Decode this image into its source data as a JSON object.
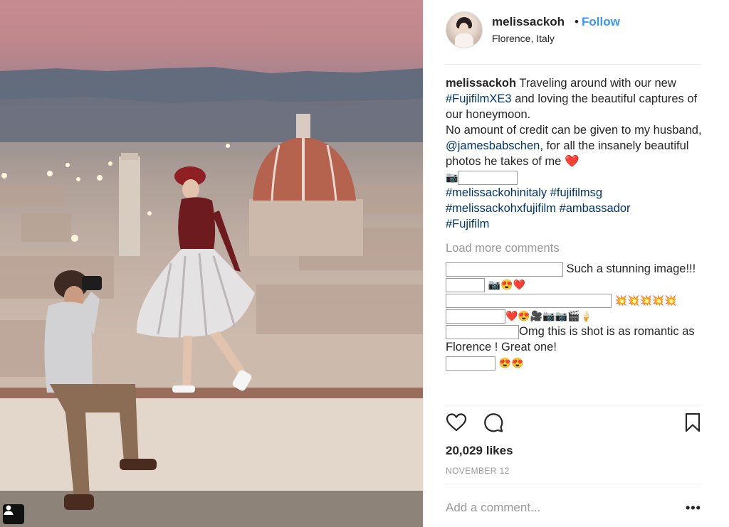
{
  "post": {
    "username": "melissackoh",
    "separator": "•",
    "follow_label": "Follow",
    "location": "Florence, Italy"
  },
  "caption": {
    "username": "melissackoh",
    "text_1": " Traveling around with our new ",
    "hashtag_xe3": "#FujifilmXE3",
    "text_2": " and loving the beautiful captures of our honeymoon.",
    "text_3": "No amount of credit can be given to my husband, ",
    "mention": "@jamesbabschen",
    "text_4": ", for all the insanely beautiful photos he takes of me ",
    "heart": "❤️",
    "camera": "📷",
    "hashtags": [
      "#melissackohinitaly",
      "#fujifilmsg",
      "#melissackohxfujifilm",
      "#ambassador",
      "#Fujifilm"
    ]
  },
  "load_more_label": "Load more comments",
  "comments": [
    {
      "text": "Such a stunning image!!!"
    },
    {
      "text": "📷😍❤️"
    },
    {
      "text": "💥💥💥💥💥"
    },
    {
      "text": "❤️😍🎥📷📷🎬🍦"
    },
    {
      "text": "Omg this is shot is as romantic as Florence ! Great one!"
    },
    {
      "text": "😍😍"
    }
  ],
  "likes": "20,029 likes",
  "date": "NOVEMBER 12",
  "add_comment_placeholder": "Add a comment...",
  "more_label": "•••",
  "icons": [
    "heart-icon",
    "comment-icon",
    "bookmark-icon",
    "user-tag-icon"
  ]
}
